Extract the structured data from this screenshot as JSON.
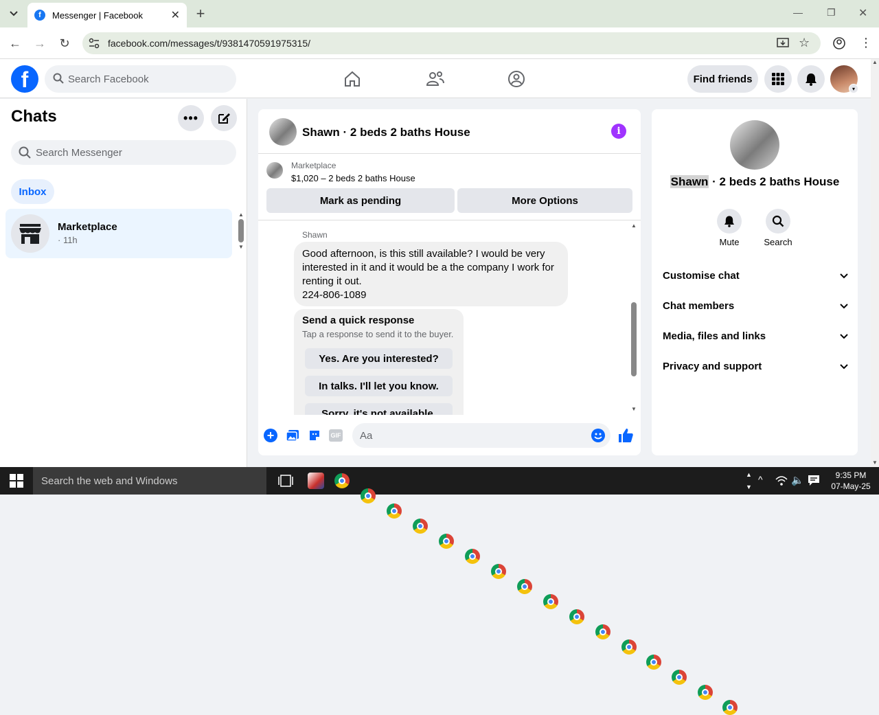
{
  "browser": {
    "tab_title": "Messenger | Facebook",
    "url": "facebook.com/messages/t/9381470591975315/"
  },
  "facebook": {
    "logo_letter": "f",
    "search_placeholder": "Search Facebook",
    "find_friends": "Find friends"
  },
  "sidebar": {
    "title": "Chats",
    "search_placeholder": "Search Messenger",
    "inbox_label": "Inbox",
    "chat": {
      "name": "Marketplace",
      "time": "· 11h"
    }
  },
  "conversation": {
    "header_title": "Shawn · 2 beds 2 baths House",
    "listing_source": "Marketplace",
    "listing_title": "$1,020 – 2 beds 2 baths House",
    "mark_pending": "Mark as pending",
    "more_options": "More Options",
    "sender": "Shawn",
    "message_lines": [
      "Good afternoon, is this still available?  I would be very",
      "interested in it and it would be a the company I work for",
      "renting it out.",
      "224-806-1089"
    ],
    "quick_title": "Send a quick response",
    "quick_subtitle": "Tap a response to send it to the buyer.",
    "quick_responses": [
      "Yes. Are you interested?",
      "In talks. I'll let you know.",
      "Sorry, it's not available."
    ],
    "composer_placeholder": "Aa"
  },
  "details": {
    "name_highlight": "Shawn",
    "name_rest": " · 2 beds 2 baths House",
    "mute_label": "Mute",
    "search_label": "Search",
    "rows": [
      "Customise chat",
      "Chat members",
      "Media, files and links",
      "Privacy and support"
    ]
  },
  "taskbar": {
    "search_placeholder": "Search the web and Windows",
    "time": "9:35 PM",
    "date": "07-May-25"
  },
  "colors": {
    "fb_blue": "#0866ff",
    "info_purple": "#a033ff",
    "tab_bar": "#dee8dc"
  }
}
